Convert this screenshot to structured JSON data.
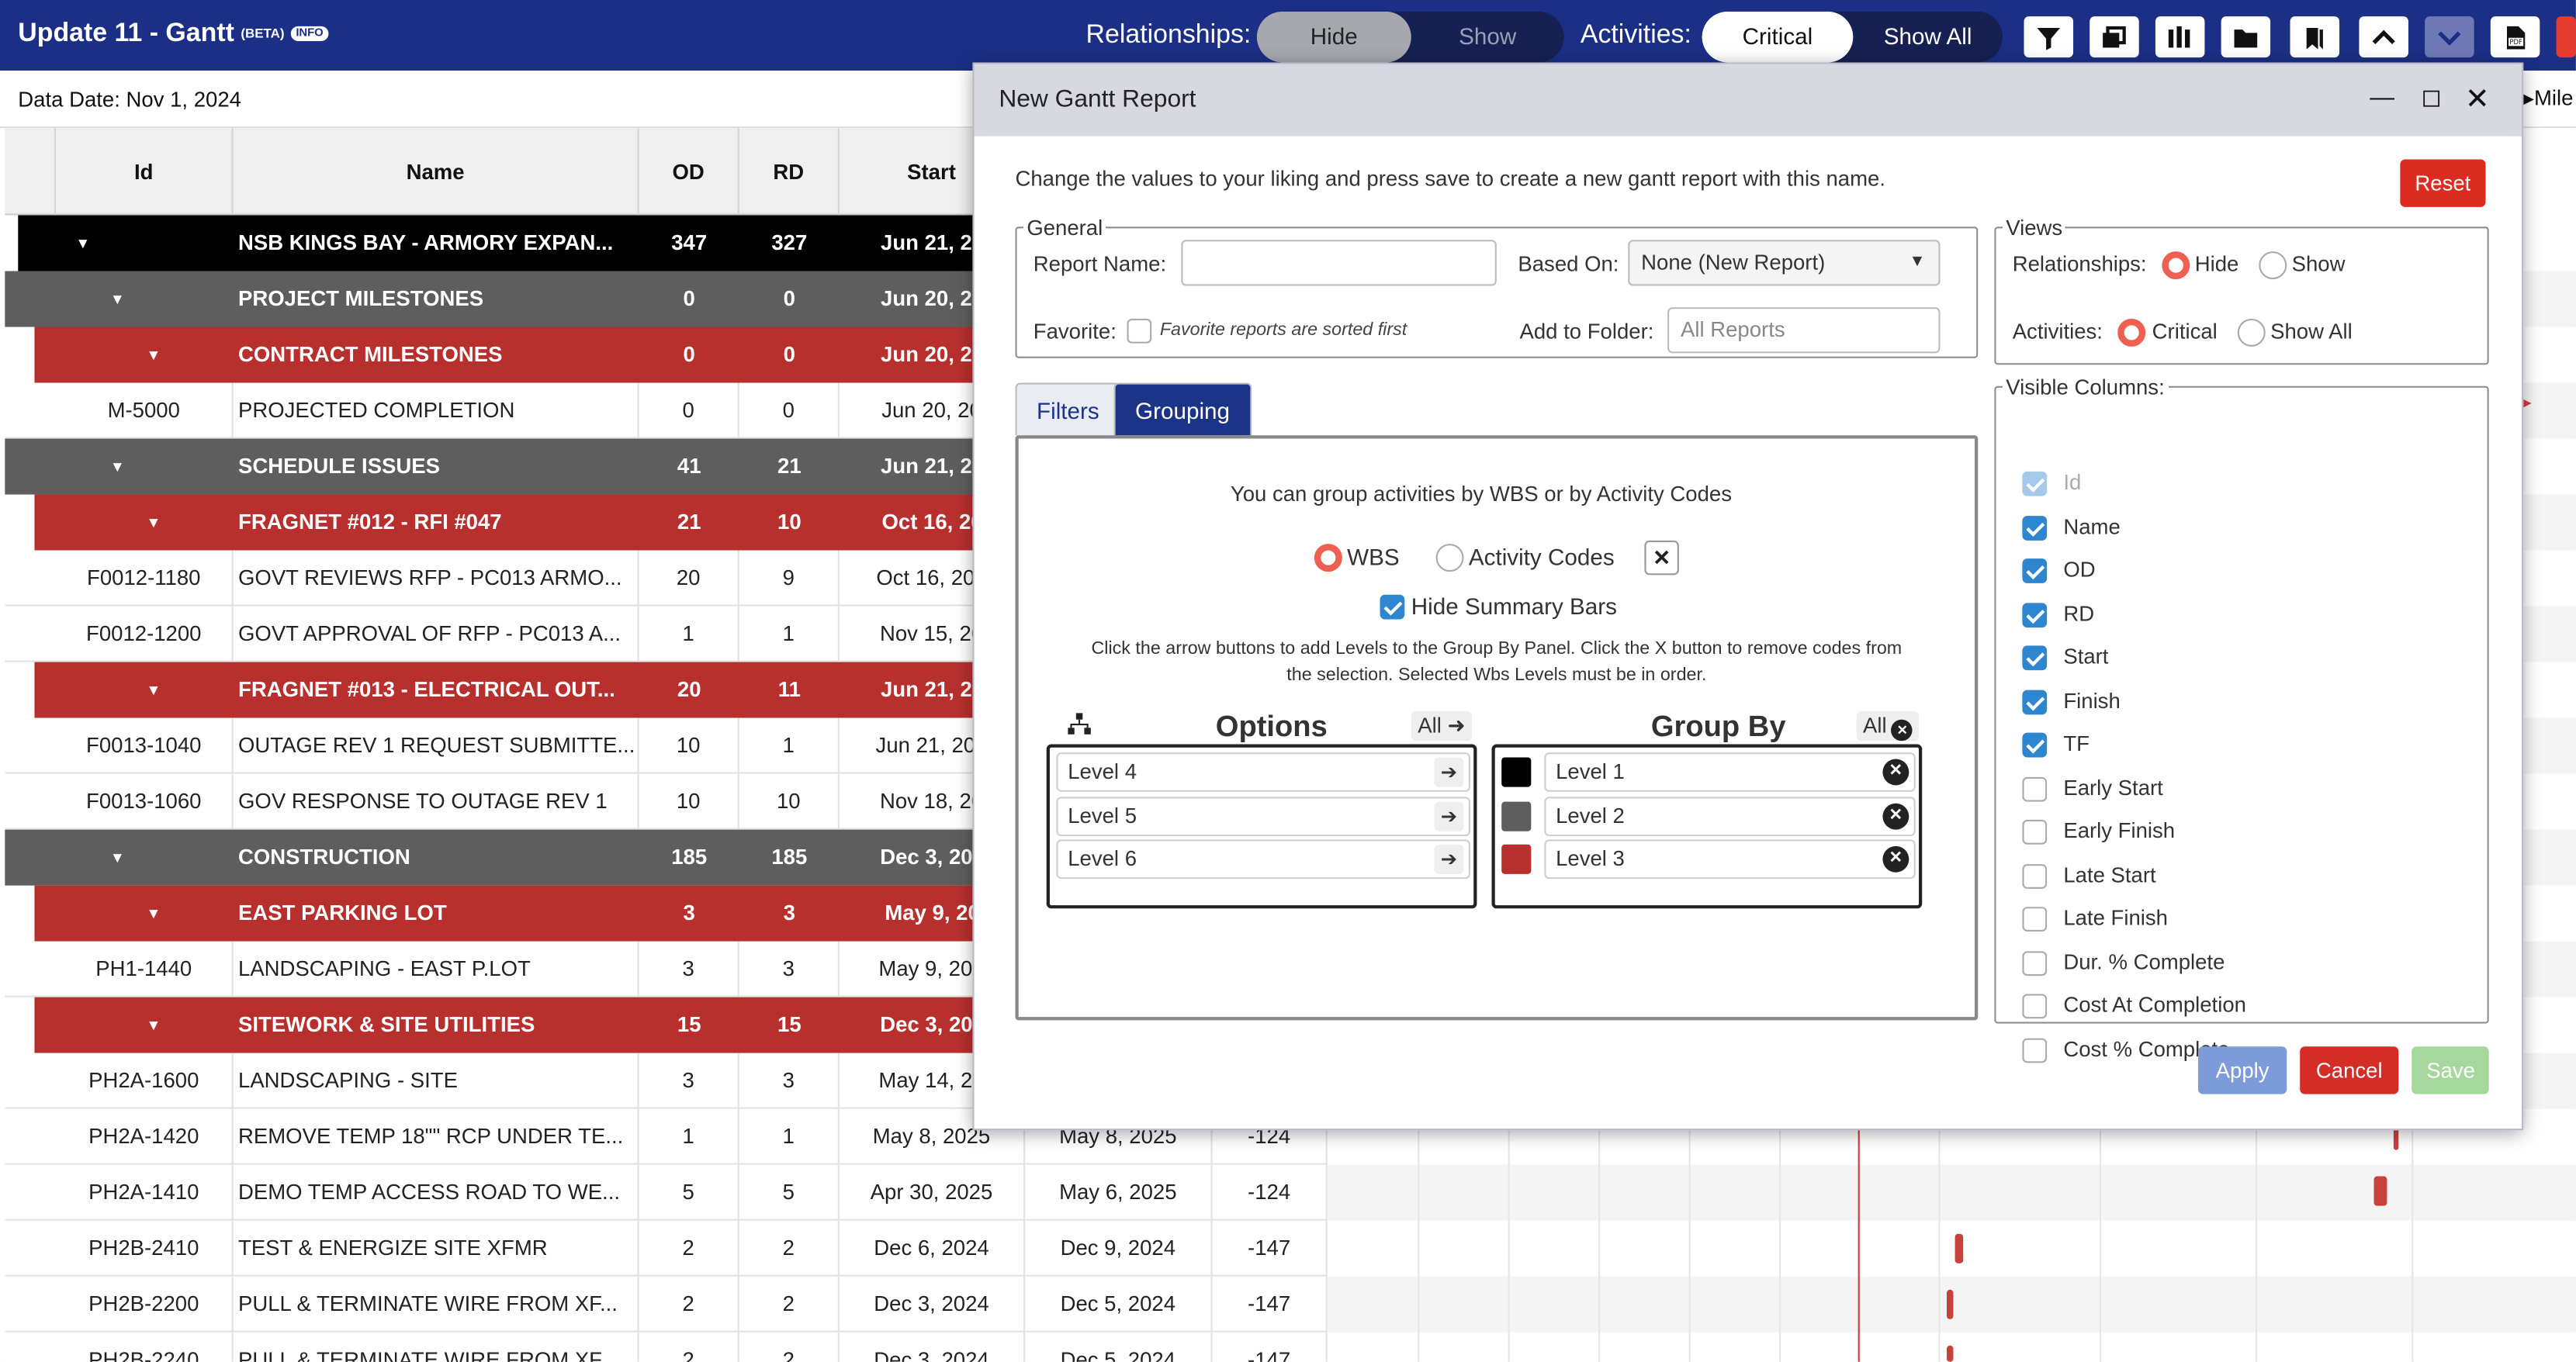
{
  "app": {
    "title": "Update 11 - Gantt",
    "beta": "(BETA)",
    "info": "INFO",
    "relationships_label": "Relationships:",
    "rel_hide": "Hide",
    "rel_show": "Show",
    "activities_label": "Activities:",
    "act_critical": "Critical",
    "act_show_all": "Show All",
    "data_date": "Data Date: Nov 1, 2024",
    "milestone_label": "Mile",
    "toolbar_icons": [
      "filter-icon",
      "layers-icon",
      "columns-icon",
      "folder-icon",
      "bookmarks-icon",
      "collapse-up-icon",
      "expand-down-icon",
      "pdf-icon"
    ]
  },
  "grid": {
    "headers": [
      "Id",
      "Name",
      "OD",
      "RD",
      "Start"
    ],
    "rows": [
      {
        "type": "l0",
        "id": "",
        "name": "NSB KINGS BAY - ARMORY EXPAN...",
        "od": "347",
        "rd": "327",
        "start": "Jun 21, 20"
      },
      {
        "type": "l1",
        "id": "",
        "name": "PROJECT MILESTONES",
        "od": "0",
        "rd": "0",
        "start": "Jun 20, 20"
      },
      {
        "type": "l2",
        "id": "",
        "name": "CONTRACT MILESTONES",
        "od": "0",
        "rd": "0",
        "start": "Jun 20, 20"
      },
      {
        "type": "act",
        "id": "M-5000",
        "name": "PROJECTED COMPLETION",
        "od": "0",
        "rd": "0",
        "start": "Jun 20, 20"
      },
      {
        "type": "l1",
        "id": "",
        "name": "SCHEDULE ISSUES",
        "od": "41",
        "rd": "21",
        "start": "Jun 21, 20"
      },
      {
        "type": "l2",
        "id": "",
        "name": "FRAGNET #012 - RFI #047",
        "od": "21",
        "rd": "10",
        "start": "Oct 16, 20"
      },
      {
        "type": "act",
        "id": "F0012-1180",
        "name": "GOVT REVIEWS RFP - PC013 ARMO...",
        "od": "20",
        "rd": "9",
        "start": "Oct 16, 202"
      },
      {
        "type": "act",
        "id": "F0012-1200",
        "name": "GOVT APPROVAL OF RFP - PC013 A...",
        "od": "1",
        "rd": "1",
        "start": "Nov 15, 20"
      },
      {
        "type": "l2",
        "id": "",
        "name": "FRAGNET #013 - ELECTRICAL OUT...",
        "od": "20",
        "rd": "11",
        "start": "Jun 21, 20"
      },
      {
        "type": "act",
        "id": "F0013-1040",
        "name": "OUTAGE REV 1 REQUEST SUBMITTE...",
        "od": "10",
        "rd": "1",
        "start": "Jun 21, 202"
      },
      {
        "type": "act",
        "id": "F0013-1060",
        "name": "GOV RESPONSE TO OUTAGE REV 1",
        "od": "10",
        "rd": "10",
        "start": "Nov 18, 20"
      },
      {
        "type": "l1",
        "id": "",
        "name": "CONSTRUCTION",
        "od": "185",
        "rd": "185",
        "start": "Dec 3, 202"
      },
      {
        "type": "l2",
        "id": "",
        "name": "EAST PARKING LOT",
        "od": "3",
        "rd": "3",
        "start": "May 9, 20"
      },
      {
        "type": "act",
        "id": "PH1-1440",
        "name": "LANDSCAPING - EAST P.LOT",
        "od": "3",
        "rd": "3",
        "start": "May 9, 202"
      },
      {
        "type": "l2",
        "id": "",
        "name": "SITEWORK & SITE UTILITIES",
        "od": "15",
        "rd": "15",
        "start": "Dec 3, 202"
      },
      {
        "type": "act",
        "id": "PH2A-1600",
        "name": "LANDSCAPING - SITE",
        "od": "3",
        "rd": "3",
        "start": "May 14, 20"
      },
      {
        "type": "act",
        "id": "PH2A-1420",
        "name": "REMOVE TEMP 18\"\" RCP UNDER TE...",
        "od": "1",
        "rd": "1",
        "start": "May 8, 2025",
        "finish": "May 8, 2025",
        "tf": "-124"
      },
      {
        "type": "act",
        "id": "PH2A-1410",
        "name": "DEMO TEMP ACCESS ROAD TO WE...",
        "od": "5",
        "rd": "5",
        "start": "Apr 30, 2025",
        "finish": "May 6, 2025",
        "tf": "-124"
      },
      {
        "type": "act",
        "id": "PH2B-2410",
        "name": "TEST & ENERGIZE SITE XFMR",
        "od": "2",
        "rd": "2",
        "start": "Dec 6, 2024",
        "finish": "Dec 9, 2024",
        "tf": "-147"
      },
      {
        "type": "act",
        "id": "PH2B-2200",
        "name": "PULL & TERMINATE WIRE FROM XF...",
        "od": "2",
        "rd": "2",
        "start": "Dec 3, 2024",
        "finish": "Dec 5, 2024",
        "tf": "-147"
      },
      {
        "type": "act",
        "id": "PH2B-2240",
        "name": "PULL & TERMINATE WIRE FROM XF...",
        "od": "2",
        "rd": "2",
        "start": "Dec 3, 2024",
        "finish": "Dec 5, 2024",
        "tf": "-147"
      }
    ]
  },
  "modal": {
    "title": "New Gantt Report",
    "intro": "Change the values to your liking and press save to create a new gantt report with this name.",
    "reset": "Reset",
    "general_legend": "General",
    "report_name_label": "Report Name:",
    "report_name_value": "",
    "based_on_label": "Based On:",
    "based_on_value": "None (New Report)",
    "favorite_label": "Favorite:",
    "favorite_hint": "Favorite reports are sorted first",
    "add_to_folder_label": "Add to Folder:",
    "add_to_folder_placeholder": "All Reports",
    "views_legend": "Views",
    "views_rel_label": "Relationships:",
    "views_rel_hide": "Hide",
    "views_rel_show": "Show",
    "views_act_label": "Activities:",
    "views_act_critical": "Critical",
    "views_act_show_all": "Show All",
    "tabs": [
      "Filters",
      "Grouping"
    ],
    "group_intro": "You can group activities by WBS or by Activity Codes",
    "opt_wbs": "WBS",
    "opt_activity_codes": "Activity Codes",
    "hide_summary_bars": "Hide Summary Bars",
    "group_help_1": "Click the arrow buttons to add Levels to the Group By Panel. Click the X button to remove codes from",
    "group_help_2": "the selection. Selected Wbs Levels must be in order.",
    "options_title": "Options",
    "group_by_title": "Group By",
    "all_label": "All",
    "options_items": [
      "Level 4",
      "Level 5",
      "Level 6"
    ],
    "group_by_items": [
      {
        "label": "Level 1",
        "color": "#000000"
      },
      {
        "label": "Level 2",
        "color": "#5e5e5e"
      },
      {
        "label": "Level 3",
        "color": "#b8302e"
      }
    ],
    "visible_columns_legend": "Visible Columns:",
    "columns": [
      {
        "label": "Id",
        "checked": true,
        "disabled": true
      },
      {
        "label": "Name",
        "checked": true
      },
      {
        "label": "OD",
        "checked": true
      },
      {
        "label": "RD",
        "checked": true
      },
      {
        "label": "Start",
        "checked": true
      },
      {
        "label": "Finish",
        "checked": true
      },
      {
        "label": "TF",
        "checked": true
      },
      {
        "label": "Early Start",
        "checked": false
      },
      {
        "label": "Early Finish",
        "checked": false
      },
      {
        "label": "Late Start",
        "checked": false
      },
      {
        "label": "Late Finish",
        "checked": false
      },
      {
        "label": "Dur. % Complete",
        "checked": false
      },
      {
        "label": "Cost At Completion",
        "checked": false
      },
      {
        "label": "Cost % Complete",
        "checked": false
      }
    ],
    "apply": "Apply",
    "cancel": "Cancel",
    "save": "Save"
  }
}
